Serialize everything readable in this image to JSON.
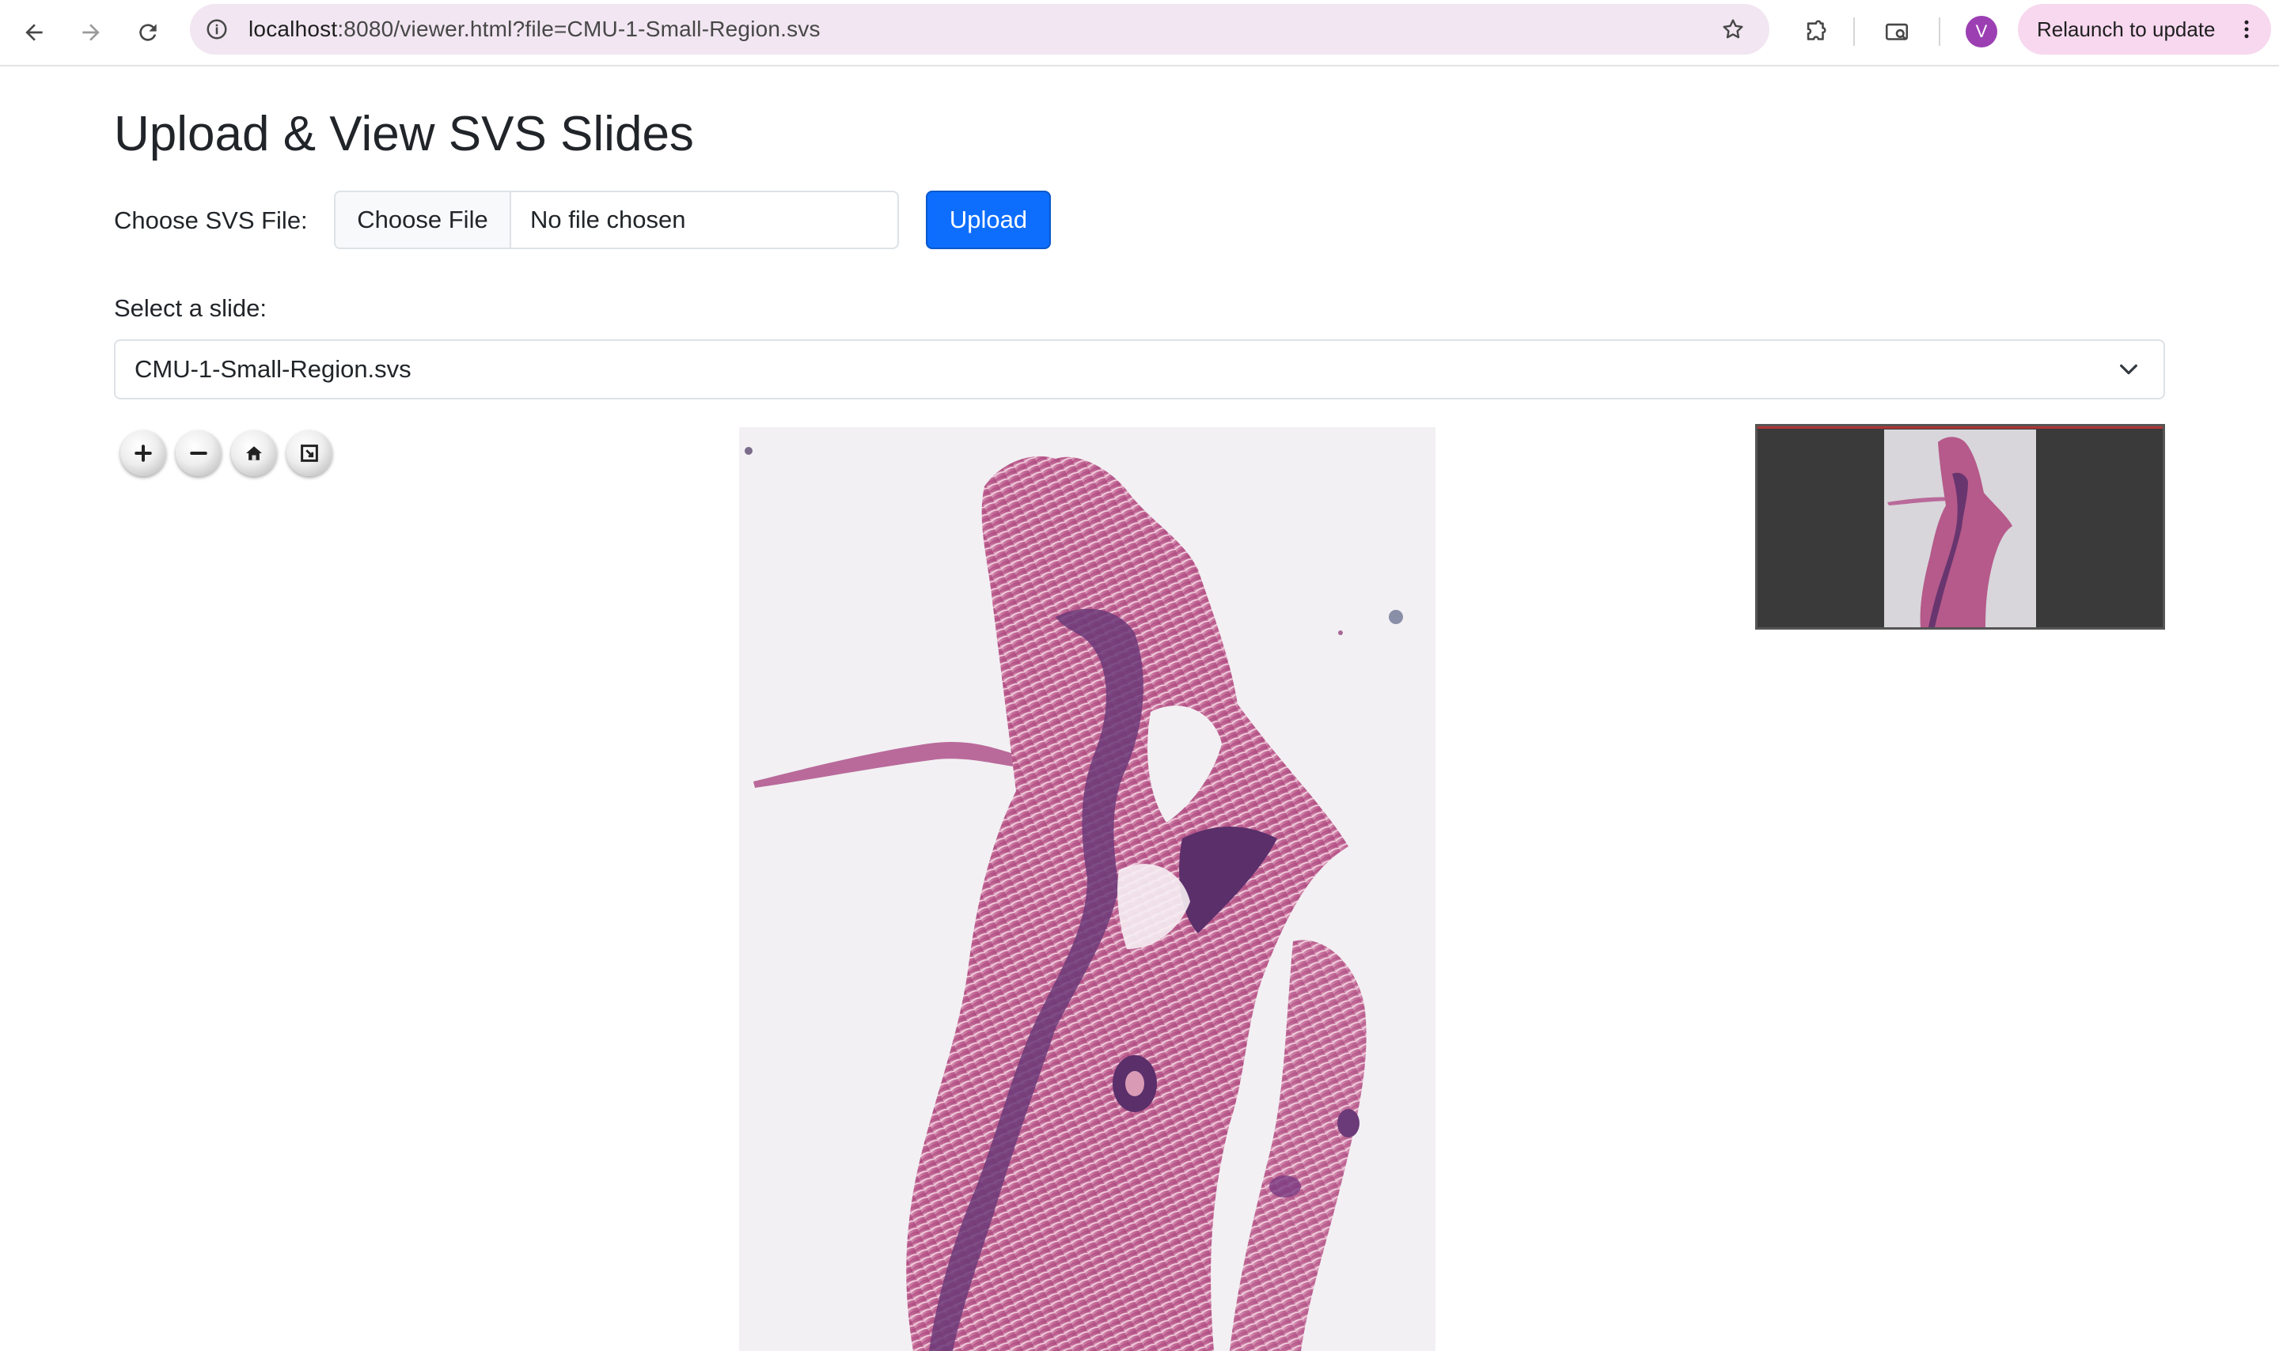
{
  "browser": {
    "url_host": "localhost",
    "url_path": ":8080/viewer.html?file=CMU-1-Small-Region.svs",
    "profile_initial": "V",
    "relaunch_label": "Relaunch to update",
    "icons": [
      "back-arrow-icon",
      "forward-arrow-icon",
      "reload-icon",
      "info-icon",
      "star-icon",
      "extensions-icon",
      "cast-icon",
      "more-vert-icon"
    ]
  },
  "page": {
    "title": "Upload & View SVS Slides",
    "file_label": "Choose SVS File:",
    "choose_file_label": "Choose File",
    "file_name": "No file chosen",
    "upload_label": "Upload",
    "select_label": "Select a slide:",
    "selected_slide": "CMU-1-Small-Region.svs"
  },
  "viewer": {
    "controls": [
      "zoom-in-icon",
      "zoom-out-icon",
      "home-icon",
      "fullscreen-icon"
    ],
    "colors": {
      "tissue_light": "#d99ab5",
      "tissue_mid": "#b55a8a",
      "tissue_dark": "#5a2f6a",
      "background": "#f2f0f3",
      "navigator_bg": "#3a3a3a"
    }
  },
  "colors": {
    "primary": "#0d6efd",
    "omnibox": "#f1e6f1",
    "relaunch": "#f7d8ef",
    "avatar": "#9c3fb3"
  }
}
